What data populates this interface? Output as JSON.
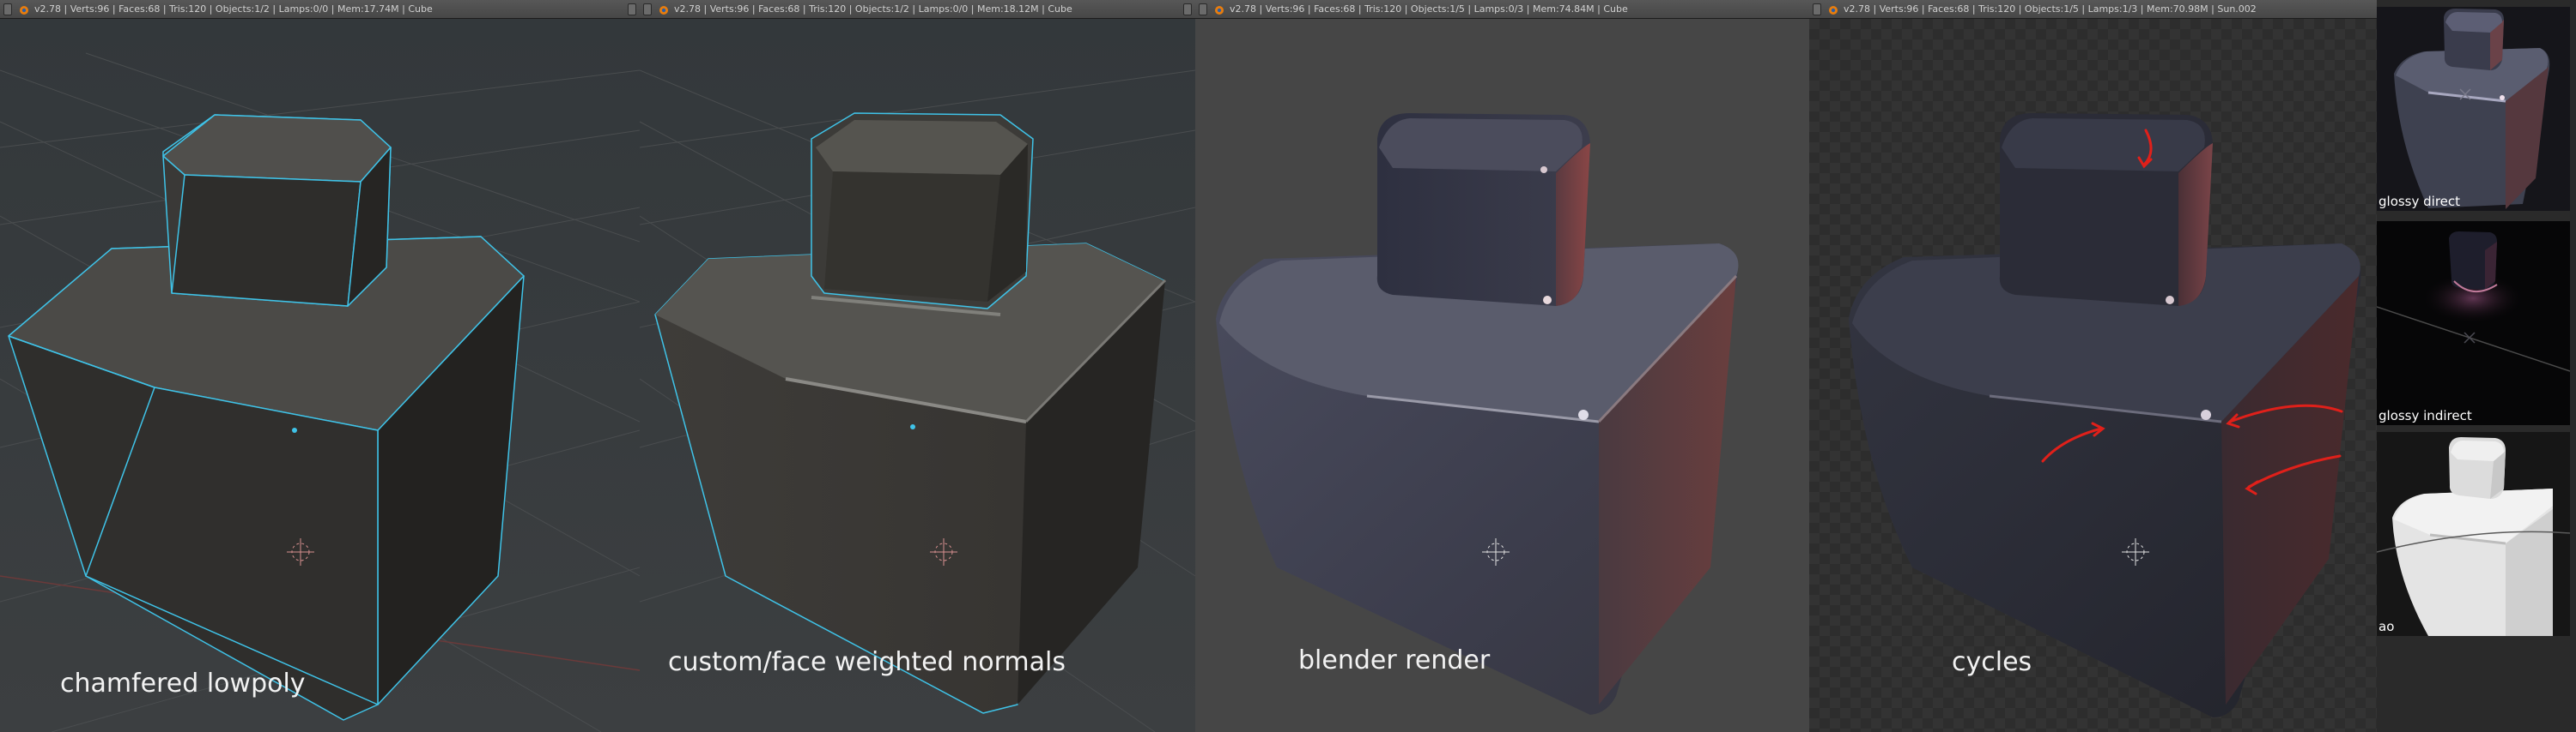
{
  "headers": [
    {
      "stats": "v2.78 | Verts:96 | Faces:68 | Tris:120 | Objects:1/2 | Lamps:0/0 | Mem:17.74M | Cube"
    },
    {
      "stats": "v2.78 | Verts:96 | Faces:68 | Tris:120 | Objects:1/2 | Lamps:0/0 | Mem:18.12M | Cube"
    },
    {
      "stats": "v2.78 | Verts:96 | Faces:68 | Tris:120 | Objects:1/5 | Lamps:0/3 | Mem:74.84M | Cube"
    },
    {
      "stats": "v2.78 | Verts:96 | Faces:68 | Tris:120 | Objects:1/5 | Lamps:1/3 | Mem:70.98M | Sun.002"
    }
  ],
  "captions": {
    "panel1": "chamfered lowpoly",
    "panel2": "custom/face weighted normals",
    "panel3": "blender render",
    "panel4": "cycles"
  },
  "passes": [
    {
      "label": "glossy direct"
    },
    {
      "label": "glossy indirect"
    },
    {
      "label": "ao"
    }
  ],
  "colors": {
    "viewport_bg": "#3a3d3f",
    "wire": "#3fc3e8",
    "render_bg": "#464646",
    "annotation": "#e0201a",
    "header": "#4f4f4f"
  }
}
